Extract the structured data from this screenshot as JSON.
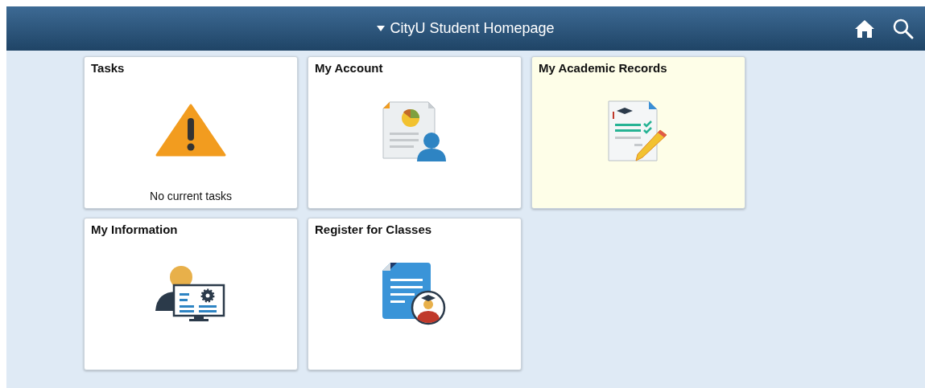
{
  "header": {
    "title": "CityU Student Homepage"
  },
  "tiles": [
    {
      "title": "Tasks",
      "kind": "warning",
      "selected": false,
      "footer": "No current tasks"
    },
    {
      "title": "My Account",
      "kind": "account",
      "selected": false
    },
    {
      "title": "My Academic Records",
      "kind": "records",
      "selected": true
    },
    {
      "title": "My Information",
      "kind": "info",
      "selected": false
    },
    {
      "title": "Register for Classes",
      "kind": "register",
      "selected": false
    }
  ]
}
